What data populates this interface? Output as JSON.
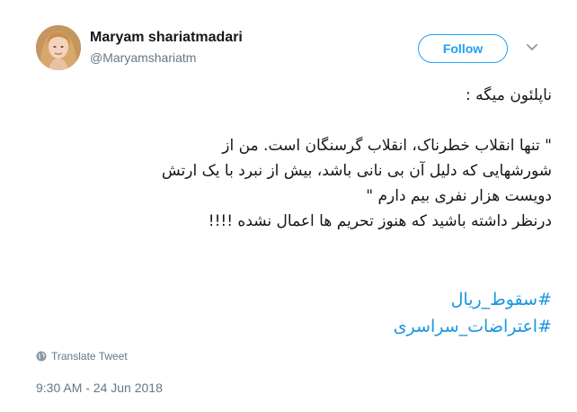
{
  "user": {
    "name": "Maryam shariatmadari",
    "handle": "@Maryamshariatm"
  },
  "follow_label": "Follow",
  "tweet": {
    "lines": [
      "ناپلئون میگه :",
      "\" تنها انقلاب خطرناک، انقلاب گرسنگان است. من از",
      "شورشهایی که دلیل آن بی نانی باشد، بیش از نبرد با یک ارتش",
      "دویست هزار نفری بیم دارم \"",
      "درنظر داشته باشید که هنوز تحریم ها اعمال نشده !!!!"
    ],
    "hashtags": [
      "#سقوط_ریال",
      "#اعتراضات_سراسری"
    ]
  },
  "translate_label": "Translate Tweet",
  "timestamp": "9:30 AM - 24 Jun 2018",
  "icons": {
    "avatar": "profile-photo",
    "menu": "chevron-down-icon",
    "translate": "globe-icon"
  },
  "colors": {
    "accent": "#1da1f2",
    "hashtag": "#1b95e0",
    "secondary_text": "#657786",
    "primary_text": "#14171a"
  }
}
